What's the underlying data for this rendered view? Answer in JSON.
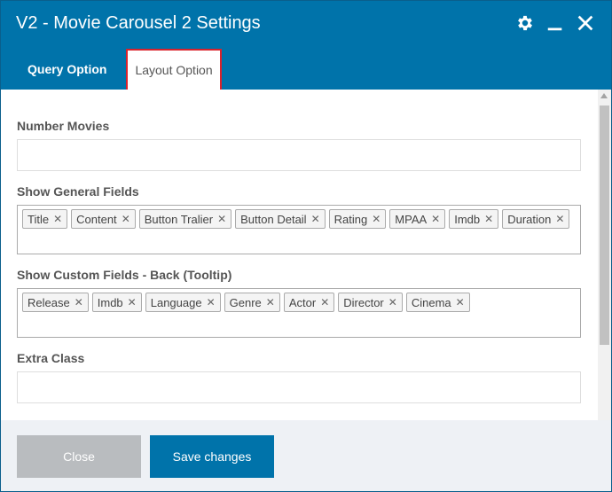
{
  "dialog": {
    "title": "V2 - Movie Carousel 2 Settings",
    "icons": [
      "gear-icon",
      "minimize-icon",
      "close-icon"
    ]
  },
  "tabs": [
    {
      "label": "Query Option",
      "active": false
    },
    {
      "label": "Layout Option",
      "active": true
    }
  ],
  "fields": {
    "number_movies": {
      "label": "Number Movies",
      "value": ""
    },
    "general_fields": {
      "label": "Show General Fields",
      "tags": [
        "Title",
        "Content",
        "Button Tralier",
        "Button Detail",
        "Rating",
        "MPAA",
        "Imdb",
        "Duration"
      ]
    },
    "custom_fields": {
      "label": "Show Custom Fields - Back (Tooltip)",
      "tags": [
        "Release",
        "Imdb",
        "Language",
        "Genre",
        "Actor",
        "Director",
        "Cinema"
      ]
    },
    "extra_class": {
      "label": "Extra Class",
      "value": ""
    }
  },
  "footer": {
    "close_label": "Close",
    "save_label": "Save changes"
  },
  "colors": {
    "header": "#0073aa",
    "active_tab_border": "#d9232d",
    "save_button": "#0073aa",
    "close_button": "#b9bcbf",
    "footer_bg": "#eef1f5"
  }
}
